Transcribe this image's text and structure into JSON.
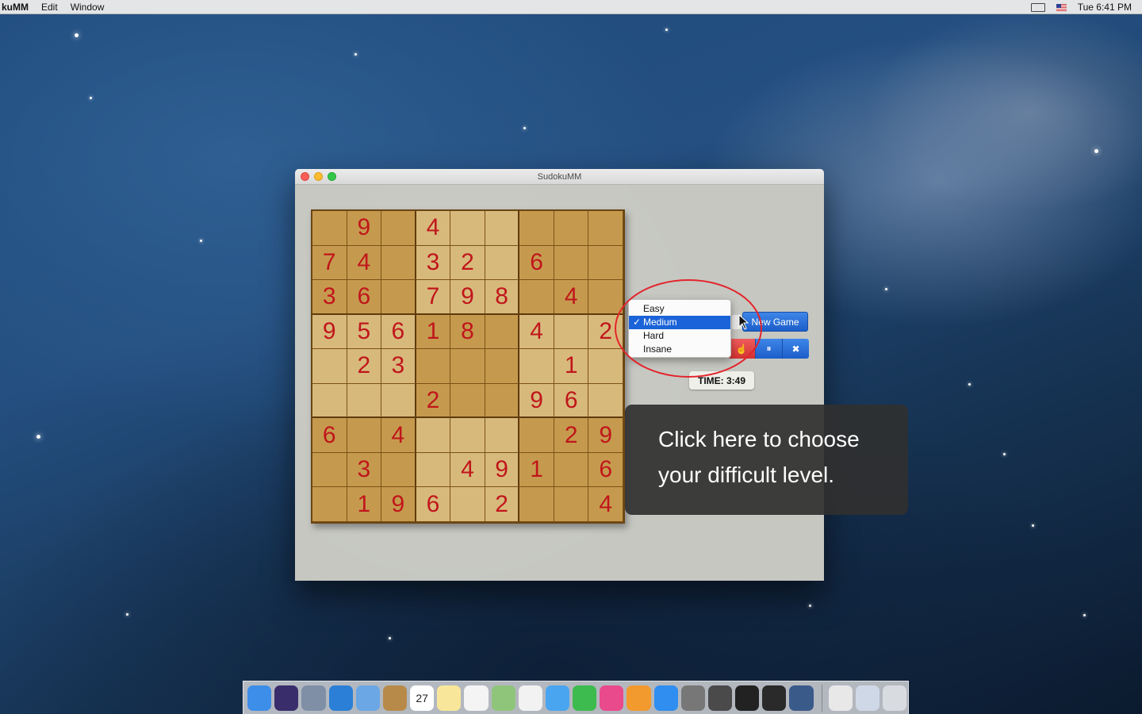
{
  "menubar": {
    "app_name": "kuMM",
    "items": [
      "Edit",
      "Window"
    ],
    "clock": "Tue 6:41 PM",
    "icons": [
      "display-mirroring-icon",
      "us-flag-input-icon"
    ]
  },
  "window": {
    "title": "SudokuMM"
  },
  "board": {
    "rows": [
      [
        "",
        "9",
        "",
        "4",
        "",
        "",
        "",
        "",
        ""
      ],
      [
        "7",
        "4",
        "",
        "3",
        "2",
        "",
        "6",
        "",
        ""
      ],
      [
        "3",
        "6",
        "",
        "7",
        "9",
        "8",
        "",
        "4",
        ""
      ],
      [
        "9",
        "5",
        "6",
        "1",
        "8",
        "",
        "4",
        "",
        "2"
      ],
      [
        "",
        "2",
        "3",
        "",
        "",
        "",
        "",
        "1",
        ""
      ],
      [
        "",
        "",
        "",
        "2",
        "",
        "",
        "9",
        "6",
        ""
      ],
      [
        "6",
        "",
        "4",
        "",
        "",
        "",
        "",
        "2",
        "9"
      ],
      [
        "",
        "3",
        "",
        "",
        "4",
        "9",
        "1",
        "",
        "6"
      ],
      [
        "",
        "1",
        "9",
        "6",
        "",
        "2",
        "",
        "",
        "4"
      ]
    ],
    "colors": {
      "dark_box": "#c69a4e",
      "light_box": "#d8b97c",
      "digit": "#c0161b"
    }
  },
  "difficulty": {
    "options": [
      "Easy",
      "Medium",
      "Hard",
      "Insane"
    ],
    "selected": "Medium",
    "check_mark": "✓"
  },
  "controls": {
    "new_game": "New Game",
    "hint_icon": "hand-icon",
    "pause_icon": "pause-icon",
    "pause_glyph": "⏸",
    "close_glyph": "✖",
    "close_icon": "close-icon"
  },
  "timer": {
    "text": "TIME: 3:49"
  },
  "tooltip": {
    "line1": "Click here to choose",
    "line2": "your difficult level."
  },
  "dock": {
    "apps": [
      "finder-icon",
      "siri-icon",
      "launchpad-icon",
      "safari-icon",
      "mail-icon",
      "contacts-icon",
      "calendar-icon",
      "notes-icon",
      "reminders-icon",
      "maps-icon",
      "photos-icon",
      "messages-icon",
      "facetime-icon",
      "itunes-icon",
      "ibooks-icon",
      "app-store-icon",
      "system-preferences-icon",
      "sublime-text-icon",
      "terminal-icon",
      "activity-monitor-icon",
      "xcode-instruments-icon"
    ],
    "calendar_day": "27",
    "right": [
      "documents-icon",
      "downloads-icon",
      "trash-icon"
    ]
  }
}
